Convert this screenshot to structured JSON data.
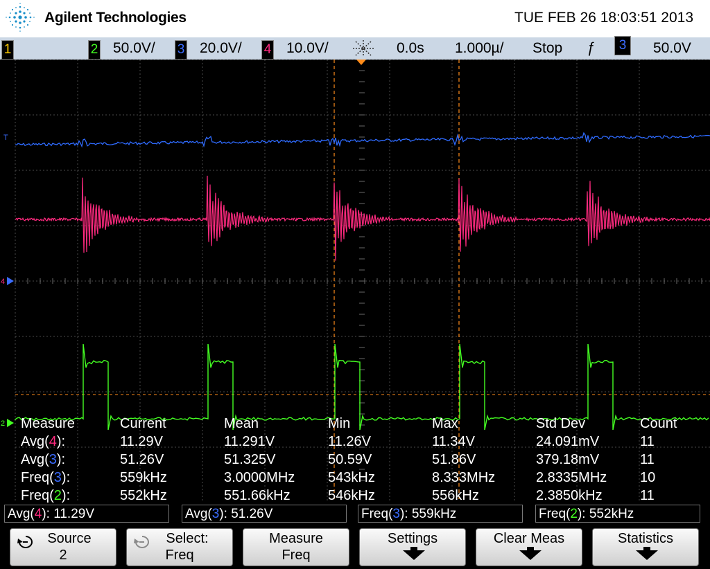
{
  "header": {
    "brand": "Agilent Technologies",
    "datetime": "TUE FEB 26 18:03:51 2013"
  },
  "status": {
    "ch1_label": "1",
    "ch2_label": "2",
    "ch2_scale": "50.0V/",
    "ch3_label": "3",
    "ch3_scale": "20.0V/",
    "ch4_label": "4",
    "ch4_scale": "10.0V/",
    "delay": "0.0s",
    "timebase": "1.000µ/",
    "run_state": "Stop",
    "trigger_edge": "ƒ",
    "trigger_source": "3",
    "trigger_level": "50.0V"
  },
  "colors": {
    "ch1": "#ffcc00",
    "ch2": "#44ff22",
    "ch3": "#3b6cff",
    "ch4": "#ff2a7f",
    "marker": "#ff8c1a"
  },
  "measure": {
    "headers": [
      "Measure",
      "Current",
      "Mean",
      "Min",
      "Max",
      "Std Dev",
      "Count"
    ],
    "rows": [
      {
        "fn": "Avg(",
        "ch": "4",
        "tail": "):",
        "current": "11.29V",
        "mean": "11.291V",
        "min": "11.26V",
        "max": "11.34V",
        "std": "24.091mV",
        "count": "11"
      },
      {
        "fn": "Avg(",
        "ch": "3",
        "tail": "):",
        "current": "51.26V",
        "mean": "51.325V",
        "min": "50.59V",
        "max": "51.86V",
        "std": "379.18mV",
        "count": "11"
      },
      {
        "fn": "Freq(",
        "ch": "3",
        "tail": "):",
        "current": "559kHz",
        "mean": "3.0000MHz",
        "min": "543kHz",
        "max": "8.333MHz",
        "std": "2.8335MHz",
        "count": "10"
      },
      {
        "fn": "Freq(",
        "ch": "2",
        "tail": "):",
        "current": "552kHz",
        "mean": "551.66kHz",
        "min": "546kHz",
        "max": "556kHz",
        "std": "2.3850kHz",
        "count": "11"
      }
    ]
  },
  "readouts": [
    {
      "fn": "Avg(",
      "ch": "4",
      "value": "): 11.29V"
    },
    {
      "fn": "Avg(",
      "ch": "3",
      "value": "): 51.26V"
    },
    {
      "fn": "Freq(",
      "ch": "3",
      "value": "): 559kHz"
    },
    {
      "fn": "Freq(",
      "ch": "2",
      "value": "): 552kHz"
    }
  ],
  "softkeys": {
    "source_l1": "Source",
    "source_l2": "2",
    "select_l1": "Select:",
    "select_l2": "Freq",
    "measure_l1": "Measure",
    "measure_l2": "Freq",
    "settings": "Settings",
    "clear": "Clear Meas",
    "statistics": "Statistics"
  },
  "markers": {
    "trigger_level": "T",
    "ch3_ground": "3",
    "ch4_ground": "4",
    "ch2_ground": "2"
  }
}
